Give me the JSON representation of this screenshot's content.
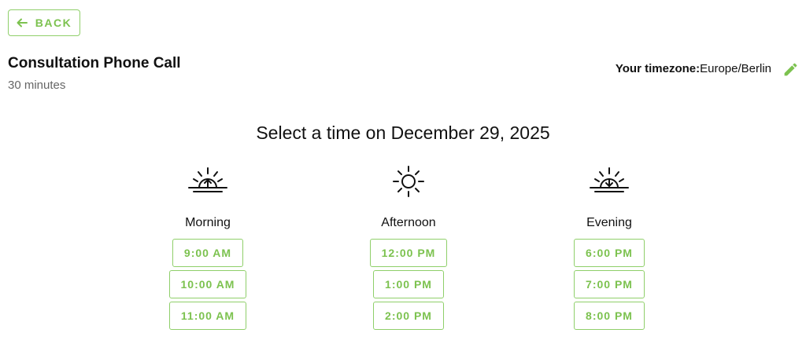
{
  "header": {
    "back_label": "BACK",
    "event_title": "Consultation Phone Call",
    "event_duration": "30 minutes",
    "timezone_label": "Your timezone:",
    "timezone_value": "Europe/Berlin"
  },
  "icons": {
    "back": "arrow-left-icon",
    "edit": "pencil-icon",
    "morning": "sunrise-icon",
    "afternoon": "sun-icon",
    "evening": "sunset-icon"
  },
  "colors": {
    "accent": "#7cc24f",
    "accent_border": "#8fcf6a",
    "text": "#111111",
    "muted": "#666666"
  },
  "heading": "Select a time on December 29, 2025",
  "periods": [
    {
      "label": "Morning",
      "slots": [
        "9:00 AM",
        "10:00 AM",
        "11:00 AM"
      ]
    },
    {
      "label": "Afternoon",
      "slots": [
        "12:00 PM",
        "1:00 PM",
        "2:00 PM"
      ]
    },
    {
      "label": "Evening",
      "slots": [
        "6:00 PM",
        "7:00 PM",
        "8:00 PM"
      ]
    }
  ]
}
